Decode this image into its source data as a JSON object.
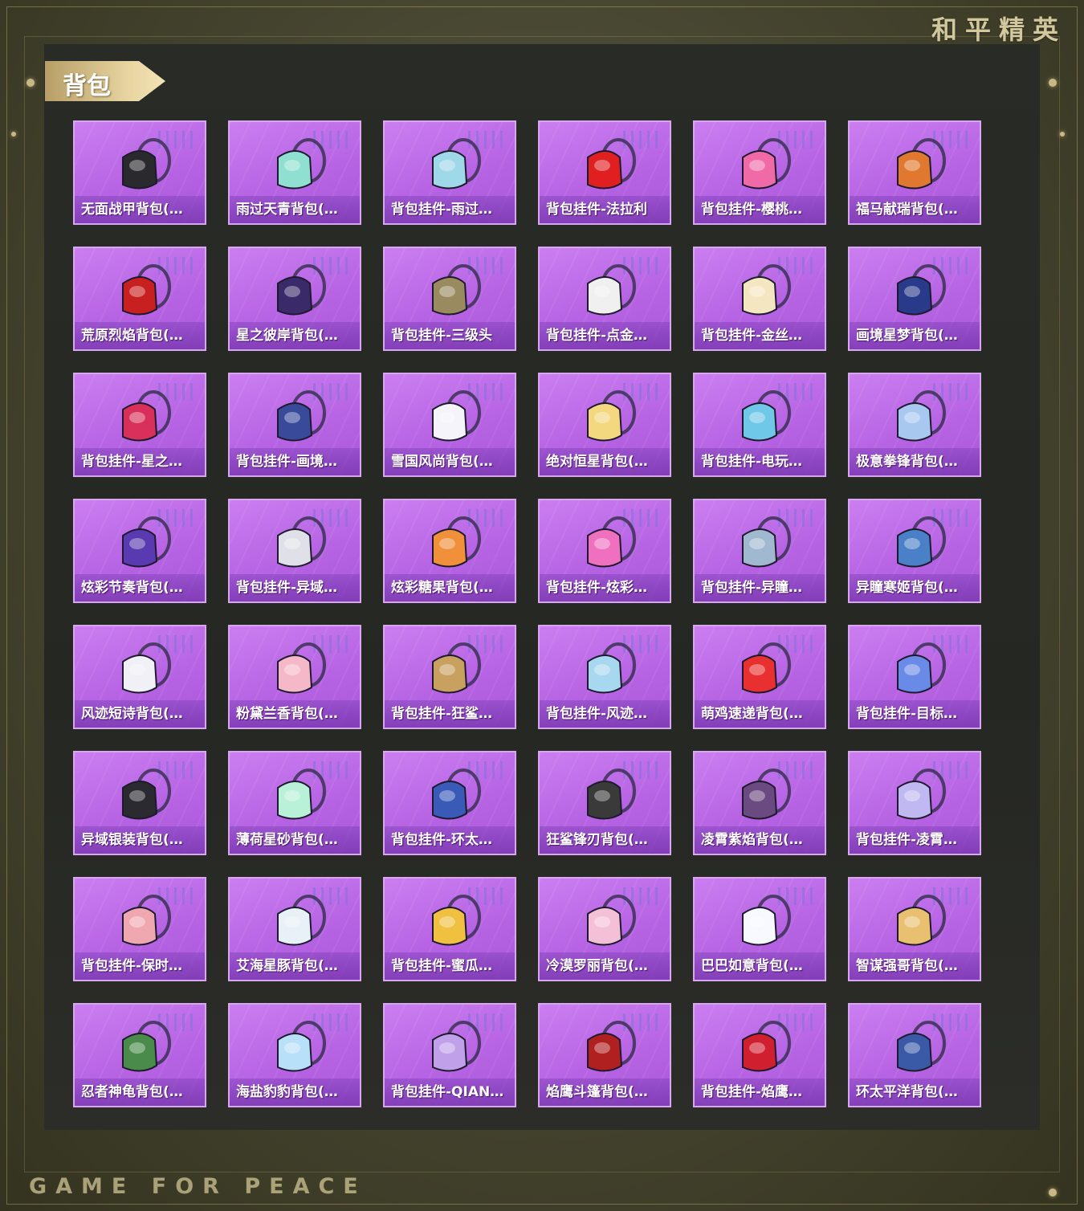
{
  "brand": "和平精英",
  "footer": "GAME FOR PEACE",
  "section_title": "背包",
  "items": [
    {
      "label": "无面战甲背包(…",
      "icon": "black-armor-backpack-icon",
      "color": "#2a2a2e"
    },
    {
      "label": "雨过天青背包(…",
      "icon": "celadon-bag-icon",
      "color": "#8fe0d0"
    },
    {
      "label": "背包挂件-雨过…",
      "icon": "celadon-pendant-icon",
      "color": "#9fd8e8"
    },
    {
      "label": "背包挂件-法拉利",
      "icon": "ferrari-keychain-icon",
      "color": "#e02020"
    },
    {
      "label": "背包挂件-樱桃…",
      "icon": "cherry-pendant-icon",
      "color": "#f06aa8"
    },
    {
      "label": "福马献瑞背包(…",
      "icon": "lucky-horse-backpack-icon",
      "color": "#e07830"
    },
    {
      "label": "荒原烈焰背包(…",
      "icon": "flame-backpack-icon",
      "color": "#c82020"
    },
    {
      "label": "星之彼岸背包(…",
      "icon": "galaxy-backpack-icon",
      "color": "#3a2a6a"
    },
    {
      "label": "背包挂件-三级头",
      "icon": "helmet-pendant-icon",
      "color": "#9a8a60"
    },
    {
      "label": "背包挂件-点金…",
      "icon": "mask-pendant-icon",
      "color": "#f0f0f0"
    },
    {
      "label": "背包挂件-金丝…",
      "icon": "gold-mask-pendant-icon",
      "color": "#f4e6c0"
    },
    {
      "label": "画境星梦背包(…",
      "icon": "book-backpack-icon",
      "color": "#2a3a8a"
    },
    {
      "label": "背包挂件-星之…",
      "icon": "planet-pendant-icon",
      "color": "#d8305a"
    },
    {
      "label": "背包挂件-画境…",
      "icon": "magnifier-pendant-icon",
      "color": "#3a4a9a"
    },
    {
      "label": "雪国风尚背包(…",
      "icon": "snow-bunny-backpack-icon",
      "color": "#f4f4fa"
    },
    {
      "label": "绝对恒星背包(…",
      "icon": "popcorn-backpack-icon",
      "color": "#f4d880"
    },
    {
      "label": "背包挂件-电玩…",
      "icon": "arcade-pendant-icon",
      "color": "#70c8e8"
    },
    {
      "label": "极意拳锋背包(…",
      "icon": "dragon-backpack-icon",
      "color": "#a8c8f0"
    },
    {
      "label": "炫彩节奏背包(…",
      "icon": "colorful-backpack-icon",
      "color": "#5a3ab0"
    },
    {
      "label": "背包挂件-异域…",
      "icon": "wings-pendant-icon",
      "color": "#e0e0e8"
    },
    {
      "label": "炫彩糖果背包(…",
      "icon": "donut-backpack-icon",
      "color": "#f0903a"
    },
    {
      "label": "背包挂件-炫彩…",
      "icon": "candy-pendant-icon",
      "color": "#f070c0"
    },
    {
      "label": "背包挂件-异瞳…",
      "icon": "bell-pendant-icon",
      "color": "#a0b8d0"
    },
    {
      "label": "异瞳寒姬背包(…",
      "icon": "ice-backpack-icon",
      "color": "#4a80c8"
    },
    {
      "label": "风迹短诗背包(…",
      "icon": "white-bag-icon",
      "color": "#f0f0f6"
    },
    {
      "label": "粉黛兰香背包(…",
      "icon": "pink-bunny-bag-icon",
      "color": "#f4b8c8"
    },
    {
      "label": "背包挂件-狂鲨…",
      "icon": "claw-pendant-icon",
      "color": "#c8a060"
    },
    {
      "label": "背包挂件-风迹…",
      "icon": "envelope-pendant-icon",
      "color": "#a8d8f0"
    },
    {
      "label": "萌鸡速递背包(…",
      "icon": "chick-bag-icon",
      "color": "#e83030"
    },
    {
      "label": "背包挂件-目标…",
      "icon": "ring-pendant-icon",
      "color": "#6a8ae8"
    },
    {
      "label": "异域银装背包(…",
      "icon": "black-box-bag-icon",
      "color": "#2a2a30"
    },
    {
      "label": "薄荷星砂背包(…",
      "icon": "mint-bag-icon",
      "color": "#b8f0d8"
    },
    {
      "label": "背包挂件-环太…",
      "icon": "robot-pendant-icon",
      "color": "#3a5ab8"
    },
    {
      "label": "狂鲨锋刃背包(…",
      "icon": "shark-bag-icon",
      "color": "#3a3a3a"
    },
    {
      "label": "凌霄紫焰背包(…",
      "icon": "purple-heart-bag-icon",
      "color": "#6a4a80"
    },
    {
      "label": "背包挂件-凌霄…",
      "icon": "crystal-pendant-icon",
      "color": "#c0b8f0"
    },
    {
      "label": "背包挂件-保时…",
      "icon": "guitar-pendant-icon",
      "color": "#f0a8b0"
    },
    {
      "label": "艾海星豚背包(…",
      "icon": "ghost-bag-icon",
      "color": "#e8f0f8"
    },
    {
      "label": "背包挂件-蜜瓜…",
      "icon": "popsicle-pendant-icon",
      "color": "#f0c040"
    },
    {
      "label": "冷漠罗丽背包(…",
      "icon": "lolita-bag-icon",
      "color": "#f4c0d8"
    },
    {
      "label": "巴巴如意背包(…",
      "icon": "white-bunny-bag-icon",
      "color": "#f8f8ff"
    },
    {
      "label": "智谋强哥背包(…",
      "icon": "bear-bag-icon",
      "color": "#e8c070"
    },
    {
      "label": "忍者神龟背包(…",
      "icon": "turtle-backpack-icon",
      "color": "#4a8a4a"
    },
    {
      "label": "海盐豹豹背包(…",
      "icon": "seal-bag-icon",
      "color": "#b8e0f8"
    },
    {
      "label": "背包挂件-QIAN…",
      "icon": "wing-charm-pendant-icon",
      "color": "#c0a0e8"
    },
    {
      "label": "焰鹰斗篷背包(…",
      "icon": "red-black-backpack-icon",
      "color": "#b02020"
    },
    {
      "label": "背包挂件-焰鹰…",
      "icon": "knot-pendant-icon",
      "color": "#d02030"
    },
    {
      "label": "环太平洋背包(…",
      "icon": "mech-backpack-icon",
      "color": "#3a5aa8"
    }
  ]
}
